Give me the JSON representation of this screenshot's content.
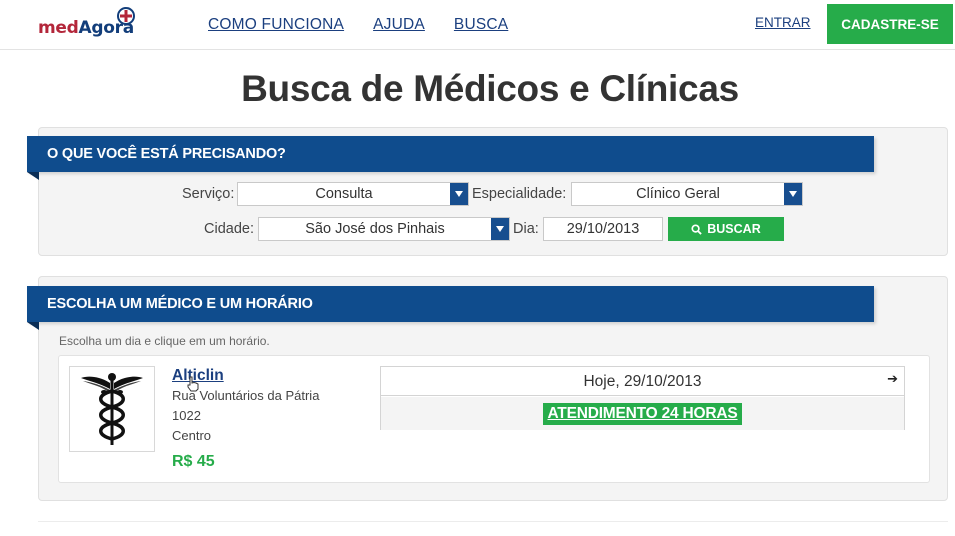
{
  "header": {
    "logo": {
      "part1": "med",
      "part2": "Agora",
      "icon": "medical-cross-icon"
    },
    "nav": [
      {
        "label": "COMO FUNCIONA"
      },
      {
        "label": "AJUDA"
      },
      {
        "label": "BUSCA"
      }
    ],
    "login_label": "ENTRAR",
    "signup_label": "CADASTRE-SE"
  },
  "page_title": "Busca de Médicos e Clínicas",
  "search_panel": {
    "heading": "O QUE VOCÊ ESTÁ PRECISANDO?",
    "service_label": "Serviço:",
    "service_value": "Consulta",
    "specialty_label": "Especialidade:",
    "specialty_value": "Clínico Geral",
    "city_label": "Cidade:",
    "city_value": "São José dos Pinhais",
    "day_label": "Dia:",
    "day_value": "29/10/2013",
    "search_button": "BUSCAR",
    "search_icon": "search-icon"
  },
  "results_panel": {
    "heading": "ESCOLHA UM MÉDICO E UM HORÁRIO",
    "hint": "Escolha um dia e clique em um horário.",
    "results": [
      {
        "name": "Alticlin",
        "address_line1": "Rua Voluntários da Pátria",
        "address_line2": "1022",
        "address_line3": "Centro",
        "price": "R$ 45",
        "image_icon": "caduceus-icon",
        "schedule_date": "Hoje, 29/10/2013",
        "next_icon": "arrow-right-icon",
        "slot_label": "ATENDIMENTO 24 HORAS"
      }
    ]
  },
  "colors": {
    "brand_blue": "#0f4c8d",
    "link_blue": "#1b3f7f",
    "green": "#26ac4a",
    "logo_red": "#b3263a"
  }
}
